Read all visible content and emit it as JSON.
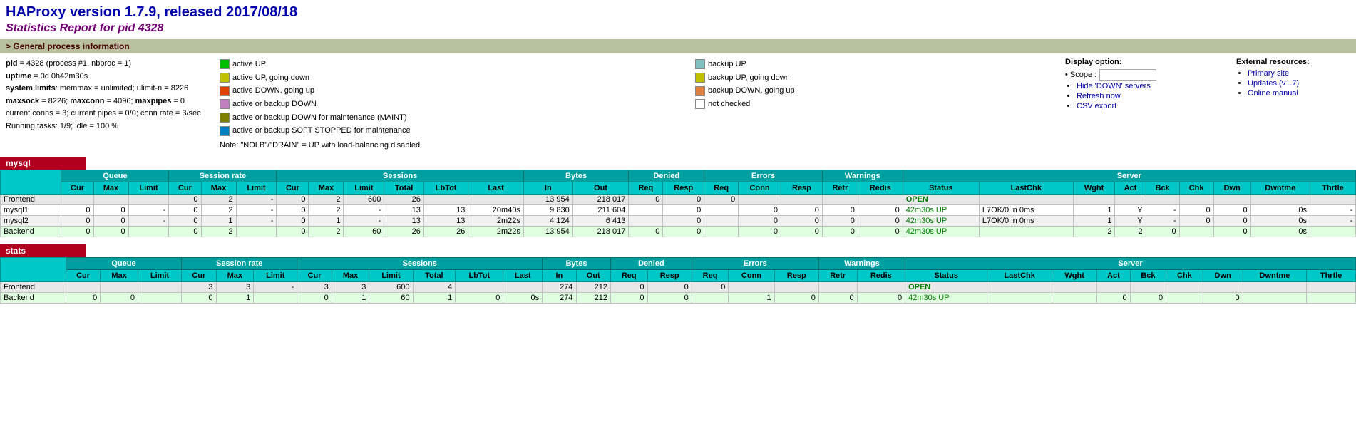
{
  "header": {
    "title": "HAProxy version 1.7.9, released 2017/08/18",
    "subtitle": "Statistics Report for pid 4328"
  },
  "general_info": {
    "section_label": "General process information",
    "sys_info": [
      {
        "label": "pid",
        "value": "= 4328 (process #1, nbproc = 1)"
      },
      {
        "label": "uptime",
        "value": "= 0d 0h42m30s"
      },
      {
        "label": "system limits",
        "value": ": memmax = unlimited; ulimit-n = 8226"
      },
      {
        "label": "maxsock",
        "value": " = 8226; maxconn = 4096; maxpipes = 0"
      },
      {
        "label": "current",
        "value": "conns = 3; current pipes = 0/0; conn rate = 3/sec"
      },
      {
        "label": "running",
        "value": "tasks: 1/9; idle = 100 %"
      }
    ]
  },
  "legend": {
    "items_left": [
      {
        "color": "#00c000",
        "label": "active UP"
      },
      {
        "color": "#c0c000",
        "label": "active UP, going down"
      },
      {
        "color": "#e04000",
        "label": "active DOWN, going up"
      },
      {
        "color": "#c080c0",
        "label": "active or backup DOWN"
      },
      {
        "color": "#808000",
        "label": "active or backup DOWN for maintenance (MAINT)"
      },
      {
        "color": "#0080c0",
        "label": "active or backup SOFT STOPPED for maintenance"
      }
    ],
    "items_right": [
      {
        "color": "#80c0c0",
        "label": "backup UP"
      },
      {
        "color": "#c0c000",
        "label": "backup UP, going down"
      },
      {
        "color": "#e08040",
        "label": "backup DOWN, going up"
      },
      {
        "color": "#ffffff",
        "label": "not checked"
      }
    ],
    "note": "Note: \"NOLB\"/\"DRAIN\" = UP with load-balancing disabled."
  },
  "display_options": {
    "title": "Display option:",
    "scope_label": "Scope :",
    "links": [
      {
        "label": "Hide 'DOWN' servers",
        "href": "#"
      },
      {
        "label": "Refresh now",
        "href": "#"
      },
      {
        "label": "CSV export",
        "href": "#"
      }
    ]
  },
  "external_resources": {
    "title": "External resources:",
    "links": [
      {
        "label": "Primary site",
        "href": "#"
      },
      {
        "label": "Updates (v1.7)",
        "href": "#"
      },
      {
        "label": "Online manual",
        "href": "#"
      }
    ]
  },
  "proxies": [
    {
      "name": "mysql",
      "headers_group": [
        "Queue",
        "Session rate",
        "Sessions",
        "Bytes",
        "Denied",
        "Errors",
        "Warnings",
        "Server"
      ],
      "headers_sub": {
        "Queue": [
          "Cur",
          "Max",
          "Limit"
        ],
        "Session rate": [
          "Cur",
          "Max",
          "Limit"
        ],
        "Sessions": [
          "Cur",
          "Max",
          "Limit",
          "Total",
          "LbTot",
          "Last"
        ],
        "Bytes": [
          "In",
          "Out"
        ],
        "Denied": [
          "Req",
          "Resp"
        ],
        "Errors": [
          "Req",
          "Conn",
          "Resp"
        ],
        "Warnings": [
          "Retr",
          "Redis"
        ],
        "Server": [
          "Status",
          "LastChk",
          "Wght",
          "Act",
          "Bck",
          "Chk",
          "Dwn",
          "Dwntme",
          "Thrtle"
        ]
      },
      "rows": [
        {
          "name": "Frontend",
          "type": "frontend",
          "queue_cur": "",
          "queue_max": "",
          "queue_limit": "",
          "sr_cur": "0",
          "sr_max": "2",
          "sr_limit": "-",
          "sess_cur": "0",
          "sess_max": "2",
          "sess_limit": "600",
          "sess_total": "26",
          "sess_lbtot": "",
          "sess_last": "",
          "bytes_in": "13 954",
          "bytes_out": "218 017",
          "denied_req": "0",
          "denied_resp": "0",
          "err_req": "0",
          "err_conn": "",
          "err_resp": "",
          "warn_retr": "",
          "warn_redis": "",
          "status": "OPEN",
          "lastchk": "",
          "wght": "",
          "act": "",
          "bck": "",
          "chk": "",
          "dwn": "",
          "dwntme": "",
          "thrtle": ""
        },
        {
          "name": "mysql1",
          "type": "server",
          "queue_cur": "0",
          "queue_max": "0",
          "queue_limit": "-",
          "sr_cur": "0",
          "sr_max": "2",
          "sr_limit": "-",
          "sess_cur": "0",
          "sess_max": "2",
          "sess_limit": "-",
          "sess_total": "13",
          "sess_lbtot": "13",
          "sess_last": "20m40s",
          "bytes_in": "9 830",
          "bytes_out": "211 604",
          "denied_req": "",
          "denied_resp": "0",
          "err_req": "",
          "err_conn": "0",
          "err_resp": "0",
          "warn_retr": "0",
          "warn_redis": "0",
          "status": "42m30s UP",
          "lastchk": "L7OK/0 in 0ms",
          "wght": "1",
          "act": "Y",
          "bck": "-",
          "chk": "0",
          "dwn": "0",
          "dwntme": "0s",
          "thrtle": "-"
        },
        {
          "name": "mysql2",
          "type": "server",
          "queue_cur": "0",
          "queue_max": "0",
          "queue_limit": "-",
          "sr_cur": "0",
          "sr_max": "1",
          "sr_limit": "-",
          "sess_cur": "0",
          "sess_max": "1",
          "sess_limit": "-",
          "sess_total": "13",
          "sess_lbtot": "13",
          "sess_last": "2m22s",
          "bytes_in": "4 124",
          "bytes_out": "6 413",
          "denied_req": "",
          "denied_resp": "0",
          "err_req": "",
          "err_conn": "0",
          "err_resp": "0",
          "warn_retr": "0",
          "warn_redis": "0",
          "status": "42m30s UP",
          "lastchk": "L7OK/0 in 0ms",
          "wght": "1",
          "act": "Y",
          "bck": "-",
          "chk": "0",
          "dwn": "0",
          "dwntme": "0s",
          "thrtle": "-"
        },
        {
          "name": "Backend",
          "type": "backend",
          "queue_cur": "0",
          "queue_max": "0",
          "queue_limit": "",
          "sr_cur": "0",
          "sr_max": "2",
          "sr_limit": "",
          "sess_cur": "0",
          "sess_max": "2",
          "sess_limit": "60",
          "sess_total": "26",
          "sess_lbtot": "26",
          "sess_last": "2m22s",
          "bytes_in": "13 954",
          "bytes_out": "218 017",
          "denied_req": "0",
          "denied_resp": "0",
          "err_req": "",
          "err_conn": "0",
          "err_resp": "0",
          "warn_retr": "0",
          "warn_redis": "0",
          "status": "42m30s UP",
          "lastchk": "",
          "wght": "2",
          "act": "2",
          "bck": "0",
          "chk": "",
          "dwn": "0",
          "dwntme": "0s",
          "thrtle": ""
        }
      ]
    },
    {
      "name": "stats",
      "rows": [
        {
          "name": "Frontend",
          "type": "frontend",
          "queue_cur": "",
          "queue_max": "",
          "queue_limit": "",
          "sr_cur": "3",
          "sr_max": "3",
          "sr_limit": "-",
          "sess_cur": "3",
          "sess_max": "3",
          "sess_limit": "600",
          "sess_total": "4",
          "sess_lbtot": "",
          "sess_last": "",
          "bytes_in": "274",
          "bytes_out": "212",
          "denied_req": "0",
          "denied_resp": "0",
          "err_req": "0",
          "err_conn": "",
          "err_resp": "",
          "warn_retr": "",
          "warn_redis": "",
          "status": "OPEN",
          "lastchk": "",
          "wght": "",
          "act": "",
          "bck": "",
          "chk": "",
          "dwn": "",
          "dwntme": "",
          "thrtle": ""
        },
        {
          "name": "Backend",
          "type": "backend",
          "queue_cur": "0",
          "queue_max": "0",
          "queue_limit": "",
          "sr_cur": "0",
          "sr_max": "1",
          "sr_limit": "",
          "sess_cur": "0",
          "sess_max": "1",
          "sess_limit": "60",
          "sess_total": "1",
          "sess_lbtot": "0",
          "sess_last": "0s",
          "bytes_in": "274",
          "bytes_out": "212",
          "denied_req": "0",
          "denied_resp": "0",
          "err_req": "",
          "err_conn": "1",
          "err_resp": "0",
          "warn_retr": "0",
          "warn_redis": "0",
          "status": "42m30s UP",
          "lastchk": "",
          "wght": "",
          "act": "0",
          "bck": "0",
          "chk": "",
          "dwn": "0",
          "dwntme": "",
          "thrtle": ""
        }
      ]
    }
  ]
}
